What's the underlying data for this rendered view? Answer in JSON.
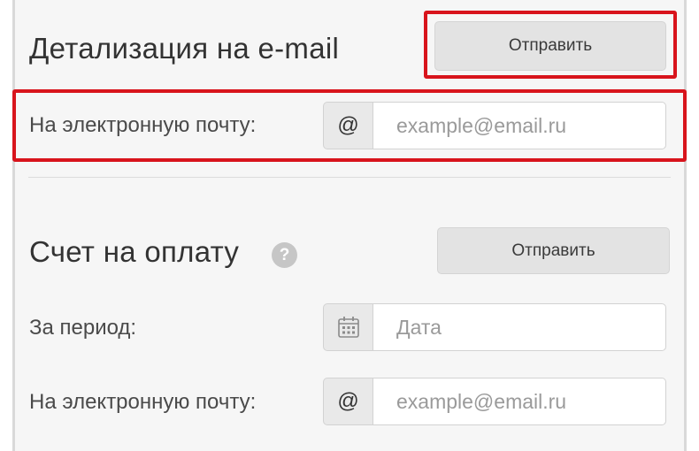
{
  "detail_section": {
    "title": "Детализация на e-mail",
    "send_label": "Отправить",
    "email_label": "На электронную почту:",
    "email_addon": "@",
    "email_placeholder": "example@email.ru"
  },
  "invoice_section": {
    "title": "Счет на оплату",
    "help_glyph": "?",
    "send_label": "Отправить",
    "period_label": "За период:",
    "period_placeholder": "Дата",
    "period_icon": "calendar-icon",
    "email_label": "На электронную почту:",
    "email_addon": "@",
    "email_placeholder": "example@email.ru"
  },
  "annotations": {
    "highlight_color": "#d8141c"
  }
}
